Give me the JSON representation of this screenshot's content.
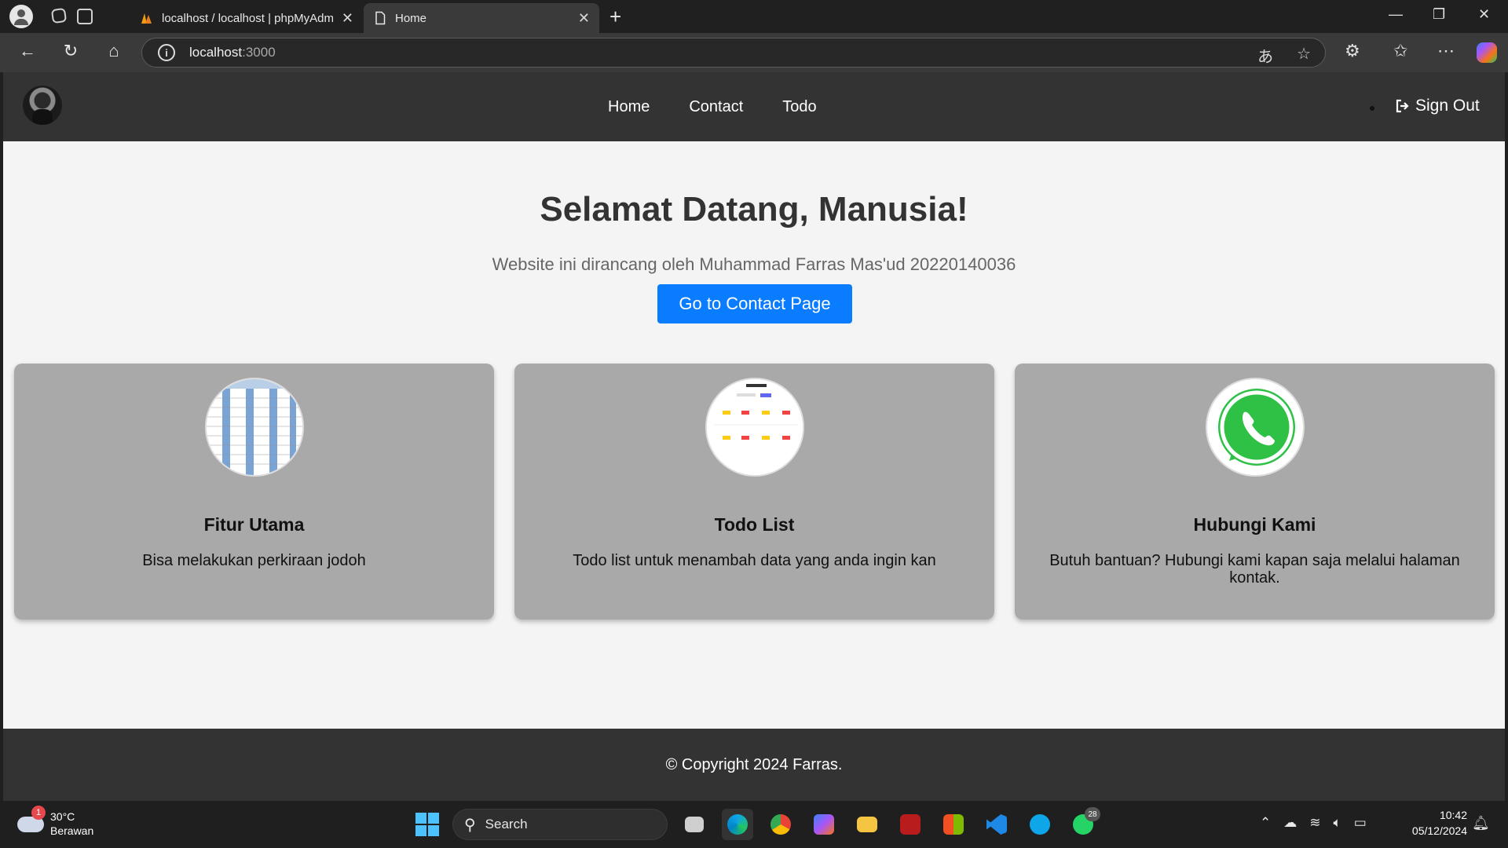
{
  "browser": {
    "tabs": [
      {
        "title": "localhost / localhost | phpMyAdm",
        "active": false
      },
      {
        "title": "Home",
        "active": true
      }
    ],
    "address": {
      "host": "localhost",
      "port": ":3000"
    }
  },
  "site": {
    "nav": {
      "links": [
        "Home",
        "Contact",
        "Todo"
      ],
      "sign_out": "Sign Out"
    },
    "hero": {
      "title": "Selamat Datang, Manusia!",
      "subtitle": "Website ini dirancang oleh Muhammad Farras Mas'ud 20220140036",
      "button": "Go to Contact Page",
      "button_color": "#0a7cff"
    },
    "cards": [
      {
        "title": "Fitur Utama",
        "text": "Bisa melakukan perkiraan jodoh",
        "image": "table-thumbnail"
      },
      {
        "title": "Todo List",
        "text": "Todo list untuk menambah data yang anda ingin kan",
        "image": "todo-thumbnail"
      },
      {
        "title": "Hubungi Kami",
        "text": "Butuh bantuan? Hubungi kami kapan saja melalui halaman kontak.",
        "image": "whatsapp-logo"
      }
    ],
    "footer": "© Copyright 2024 Farras."
  },
  "taskbar": {
    "weather": {
      "temp": "30°C",
      "condition": "Berawan",
      "badge": "1"
    },
    "search_label": "Search",
    "whatsapp_badge": "28",
    "time": "10:42",
    "date": "05/12/2024"
  }
}
